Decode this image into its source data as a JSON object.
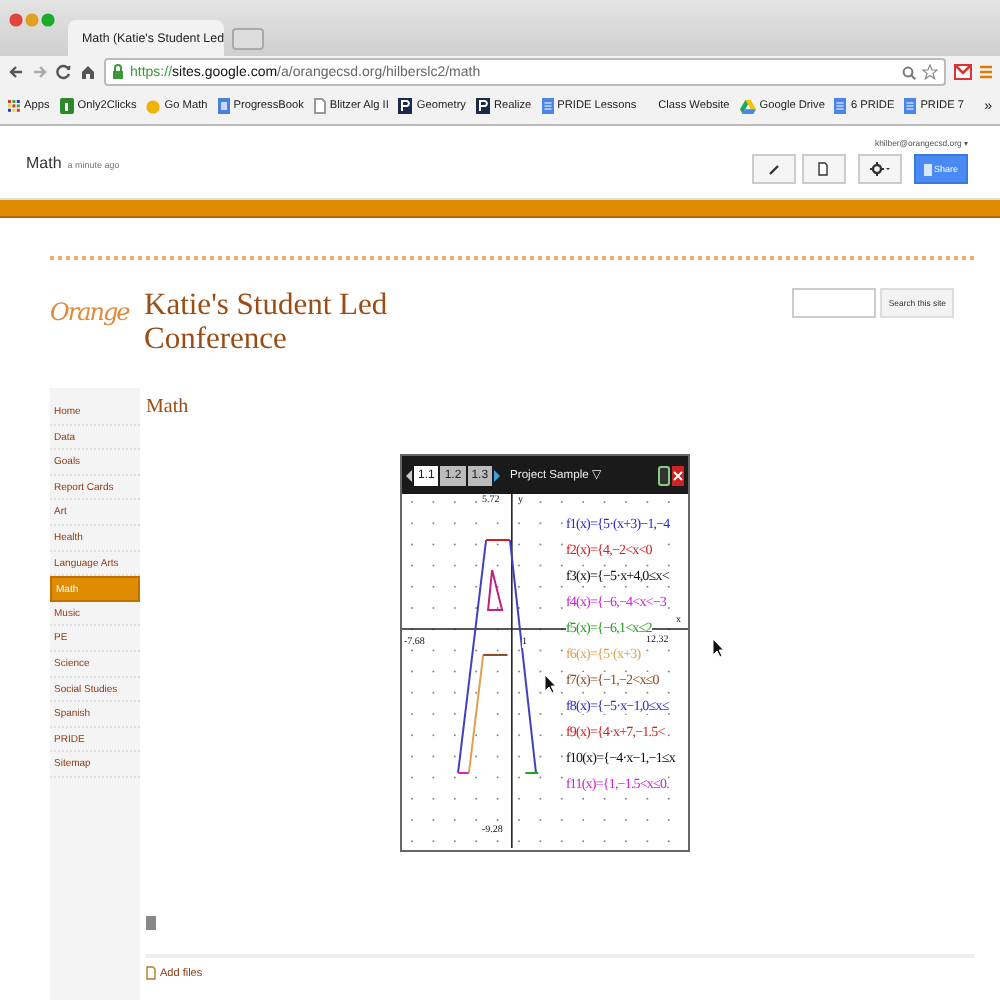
{
  "browser": {
    "tab": {
      "title": "Math (Katie's Student Led"
    },
    "address": {
      "scheme": "https://",
      "host": "sites.google.com",
      "path": "/a/orangecsd.org/hilberslc2/math"
    },
    "bookmarks": [
      {
        "label": "Apps",
        "kind": "apps"
      },
      {
        "label": "Only2Clicks",
        "kind": "hand"
      },
      {
        "label": "Go Math",
        "kind": "circle"
      },
      {
        "label": "ProgressBook",
        "kind": "square"
      },
      {
        "label": "Blitzer Alg II",
        "kind": "page"
      },
      {
        "label": "Geometry",
        "kind": "p"
      },
      {
        "label": "Realize",
        "kind": "p"
      },
      {
        "label": "PRIDE Lessons",
        "kind": "doc"
      },
      {
        "label": "Class Website",
        "kind": "none"
      },
      {
        "label": "Google Drive",
        "kind": "drive"
      },
      {
        "label": "6 PRIDE",
        "kind": "doc"
      },
      {
        "label": "PRIDE 7",
        "kind": "doc"
      }
    ],
    "more_bookmarks": "»"
  },
  "site_bar": {
    "page_title": "Math",
    "edited": "a minute ago",
    "user": "khilber@orangecsd.org ▾",
    "share": "Share"
  },
  "site": {
    "logo": "Orange",
    "title": "Katie's Student Led Conference",
    "search_button": "Search this site",
    "nav": [
      {
        "label": "Home",
        "selected": false
      },
      {
        "label": "Data",
        "selected": false
      },
      {
        "label": "Goals",
        "selected": false
      },
      {
        "label": "Report Cards",
        "selected": false
      },
      {
        "label": "Art",
        "selected": false
      },
      {
        "label": "Health",
        "selected": false
      },
      {
        "label": "Language Arts",
        "selected": false
      },
      {
        "label": "Math",
        "selected": true
      },
      {
        "label": "Music",
        "selected": false
      },
      {
        "label": "PE",
        "selected": false
      },
      {
        "label": "Science",
        "selected": false
      },
      {
        "label": "Social Studies",
        "selected": false
      },
      {
        "label": "Spanish",
        "selected": false
      },
      {
        "label": "PRIDE",
        "selected": false
      },
      {
        "label": "Sitemap",
        "selected": false
      }
    ],
    "heading": "Math",
    "calculator": {
      "tabs": [
        {
          "label": "1.1",
          "selected": true
        },
        {
          "label": "1.2",
          "selected": false
        },
        {
          "label": "1.3",
          "selected": false
        }
      ],
      "document": "Project Sample ▽",
      "axis": {
        "ymax": "5.72",
        "ylabel": "y",
        "xmin": "-7.68",
        "xlabel": "x",
        "xmax": "12.32",
        "ymin": "-9.28",
        "tick": "1"
      },
      "functions": [
        {
          "text": "f1(x)={5·(x+3)−1,−4",
          "color": "#2a2ad0"
        },
        {
          "text": "f2(x)={4,−2<x<0",
          "color": "#d02020"
        },
        {
          "text": "f3(x)={−5·x+4,0≤x<",
          "color": "#111111"
        },
        {
          "text": "f4(x)={−6,−4<x<−3",
          "color": "#d020d0"
        },
        {
          "text": "f5(x)={−6,1<x≤2",
          "color": "#20a020"
        },
        {
          "text": "f6(x)={5·(x+3)",
          "color": "#e0a050"
        },
        {
          "text": "f7(x)={−1,−2<x≤0",
          "color": "#8a4a20"
        },
        {
          "text": "f8(x)={−5·x−1,0≤x≤",
          "color": "#2a2ad0"
        },
        {
          "text": "f9(x)={4·x+7,−1.5<",
          "color": "#d02020"
        },
        {
          "text": "f10(x)={−4·x−1,−1≤x",
          "color": "#111111"
        },
        {
          "text": "f11(x)={1,−1.5<x≤0.",
          "color": "#d020d0"
        }
      ]
    },
    "add_files": "Add files"
  }
}
